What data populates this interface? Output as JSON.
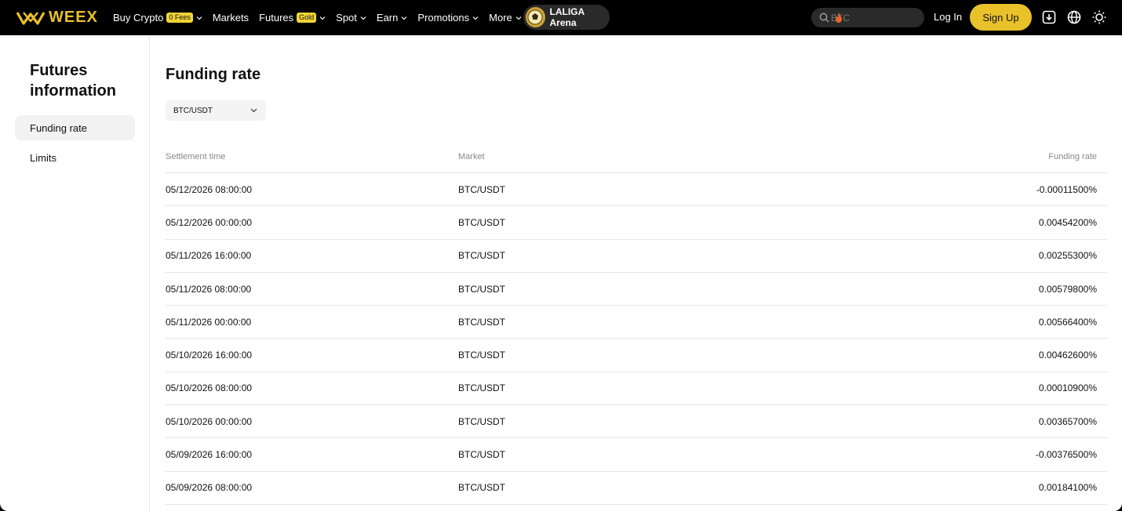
{
  "brand": {
    "name": "WEEX",
    "accent": "#E9C12A"
  },
  "nav": {
    "items": [
      {
        "label": "Buy Crypto",
        "badge": "0 Fees",
        "dropdown": true
      },
      {
        "label": "Markets",
        "badge": null,
        "dropdown": false
      },
      {
        "label": "Futures",
        "badge": "Gold",
        "dropdown": true
      },
      {
        "label": "Spot",
        "badge": null,
        "dropdown": true
      },
      {
        "label": "Earn",
        "badge": null,
        "dropdown": true
      },
      {
        "label": "Promotions",
        "badge": null,
        "dropdown": true
      },
      {
        "label": "More",
        "badge": null,
        "dropdown": true
      }
    ],
    "laliga_label": "LALIGA Arena",
    "search_placeholder": "BTC",
    "login_label": "Log In",
    "signup_label": "Sign Up",
    "icons": [
      "download-icon",
      "globe-icon",
      "theme-sun-icon"
    ]
  },
  "sidebar": {
    "title": "Futures information",
    "items": [
      {
        "label": "Funding rate",
        "active": true
      },
      {
        "label": "Limits",
        "active": false
      }
    ]
  },
  "main": {
    "title": "Funding rate",
    "selected_pair": "BTC/USDT",
    "columns": [
      "Settlement time",
      "Market",
      "Funding rate"
    ],
    "rows": [
      {
        "time": "05/12/2026 08:00:00",
        "market": "BTC/USDT",
        "rate": "-0.00011500%"
      },
      {
        "time": "05/12/2026 00:00:00",
        "market": "BTC/USDT",
        "rate": "0.00454200%"
      },
      {
        "time": "05/11/2026 16:00:00",
        "market": "BTC/USDT",
        "rate": "0.00255300%"
      },
      {
        "time": "05/11/2026 08:00:00",
        "market": "BTC/USDT",
        "rate": "0.00579800%"
      },
      {
        "time": "05/11/2026 00:00:00",
        "market": "BTC/USDT",
        "rate": "0.00566400%"
      },
      {
        "time": "05/10/2026 16:00:00",
        "market": "BTC/USDT",
        "rate": "0.00462600%"
      },
      {
        "time": "05/10/2026 08:00:00",
        "market": "BTC/USDT",
        "rate": "0.00010900%"
      },
      {
        "time": "05/10/2026 00:00:00",
        "market": "BTC/USDT",
        "rate": "0.00365700%"
      },
      {
        "time": "05/09/2026 16:00:00",
        "market": "BTC/USDT",
        "rate": "-0.00376500%"
      },
      {
        "time": "05/09/2026 08:00:00",
        "market": "BTC/USDT",
        "rate": "0.00184100%"
      }
    ]
  }
}
